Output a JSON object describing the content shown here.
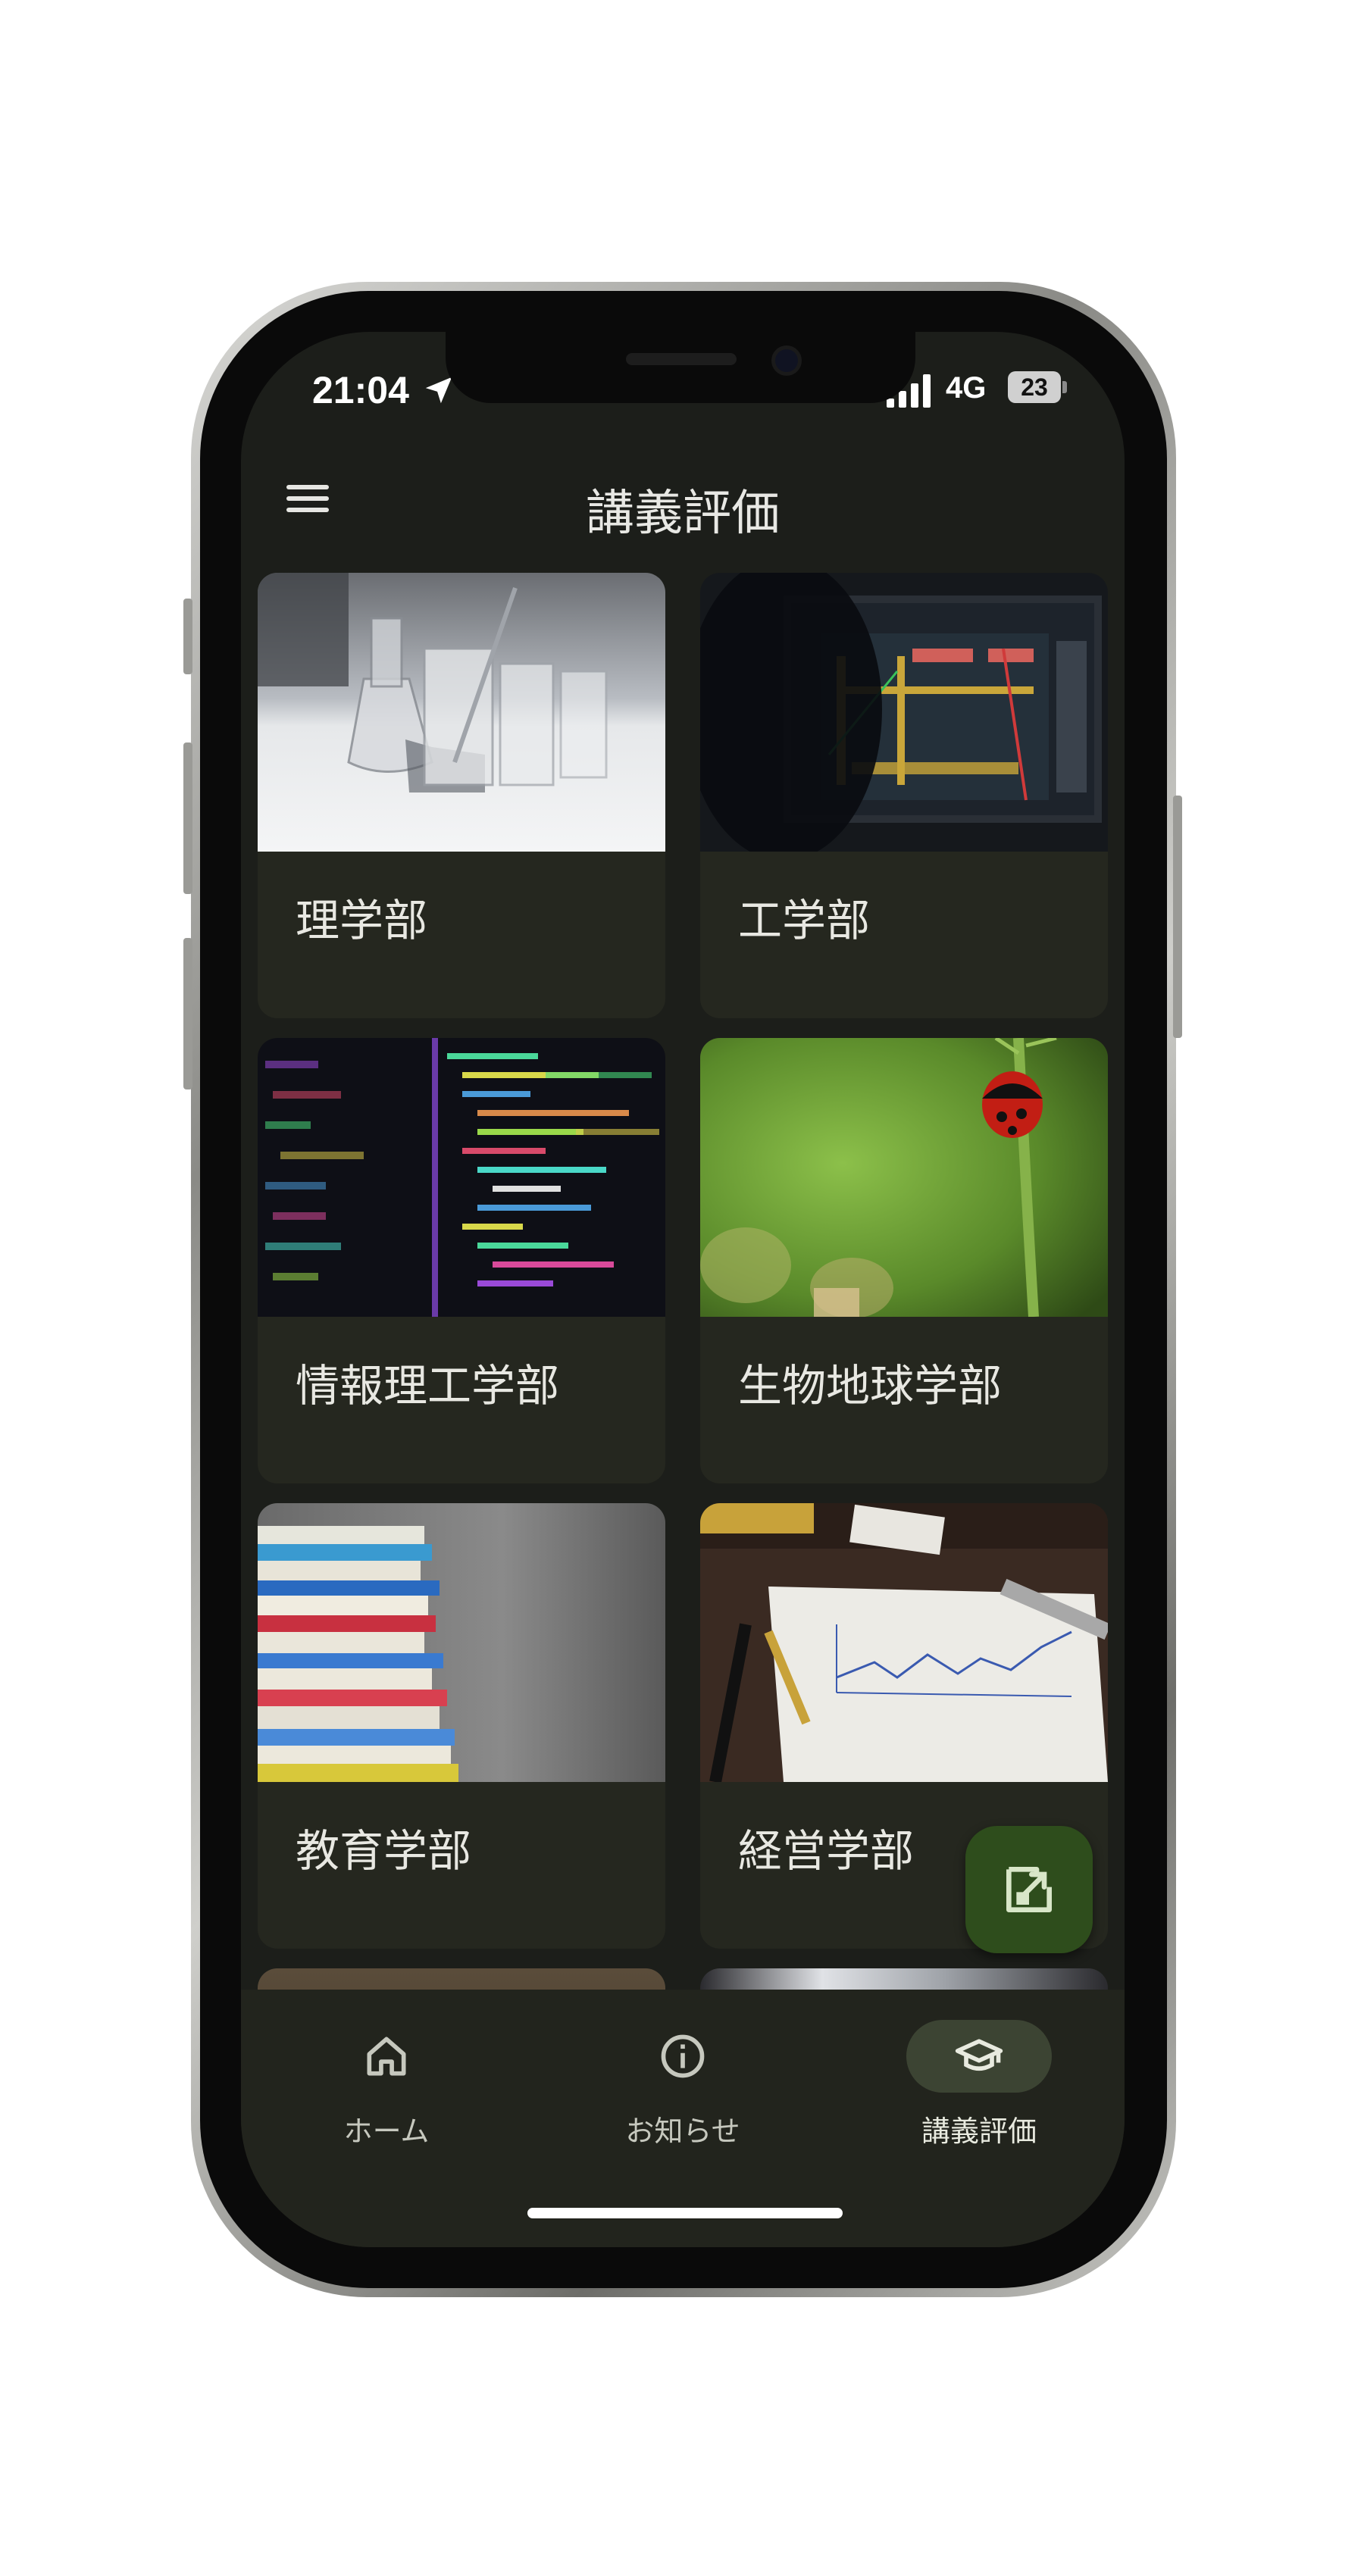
{
  "status_bar": {
    "time": "21:04",
    "network": "4G",
    "battery": "23"
  },
  "app_bar": {
    "title": "講義評価",
    "menu_icon": "hamburger-menu-icon"
  },
  "faculties": [
    {
      "label": "理学部",
      "image": "lab-glassware-photo"
    },
    {
      "label": "工学部",
      "image": "cad-monitor-photo"
    },
    {
      "label": "情報理工学部",
      "image": "source-code-photo"
    },
    {
      "label": "生物地球学部",
      "image": "ladybug-photo"
    },
    {
      "label": "教育学部",
      "image": "book-stack-photo"
    },
    {
      "label": "経営学部",
      "image": "business-chart-photo"
    }
  ],
  "fab": {
    "icon": "external-review-icon"
  },
  "bottom_nav": {
    "items": [
      {
        "label": "ホーム",
        "icon": "home-icon",
        "active": false
      },
      {
        "label": "お知らせ",
        "icon": "info-icon",
        "active": false
      },
      {
        "label": "講義評価",
        "icon": "graduation-cap-icon",
        "active": true
      }
    ]
  },
  "colors": {
    "background": "#1c1e1a",
    "card": "#25271f",
    "fab": "#2e4d1c",
    "nav_active_pill": "#3c4433"
  }
}
